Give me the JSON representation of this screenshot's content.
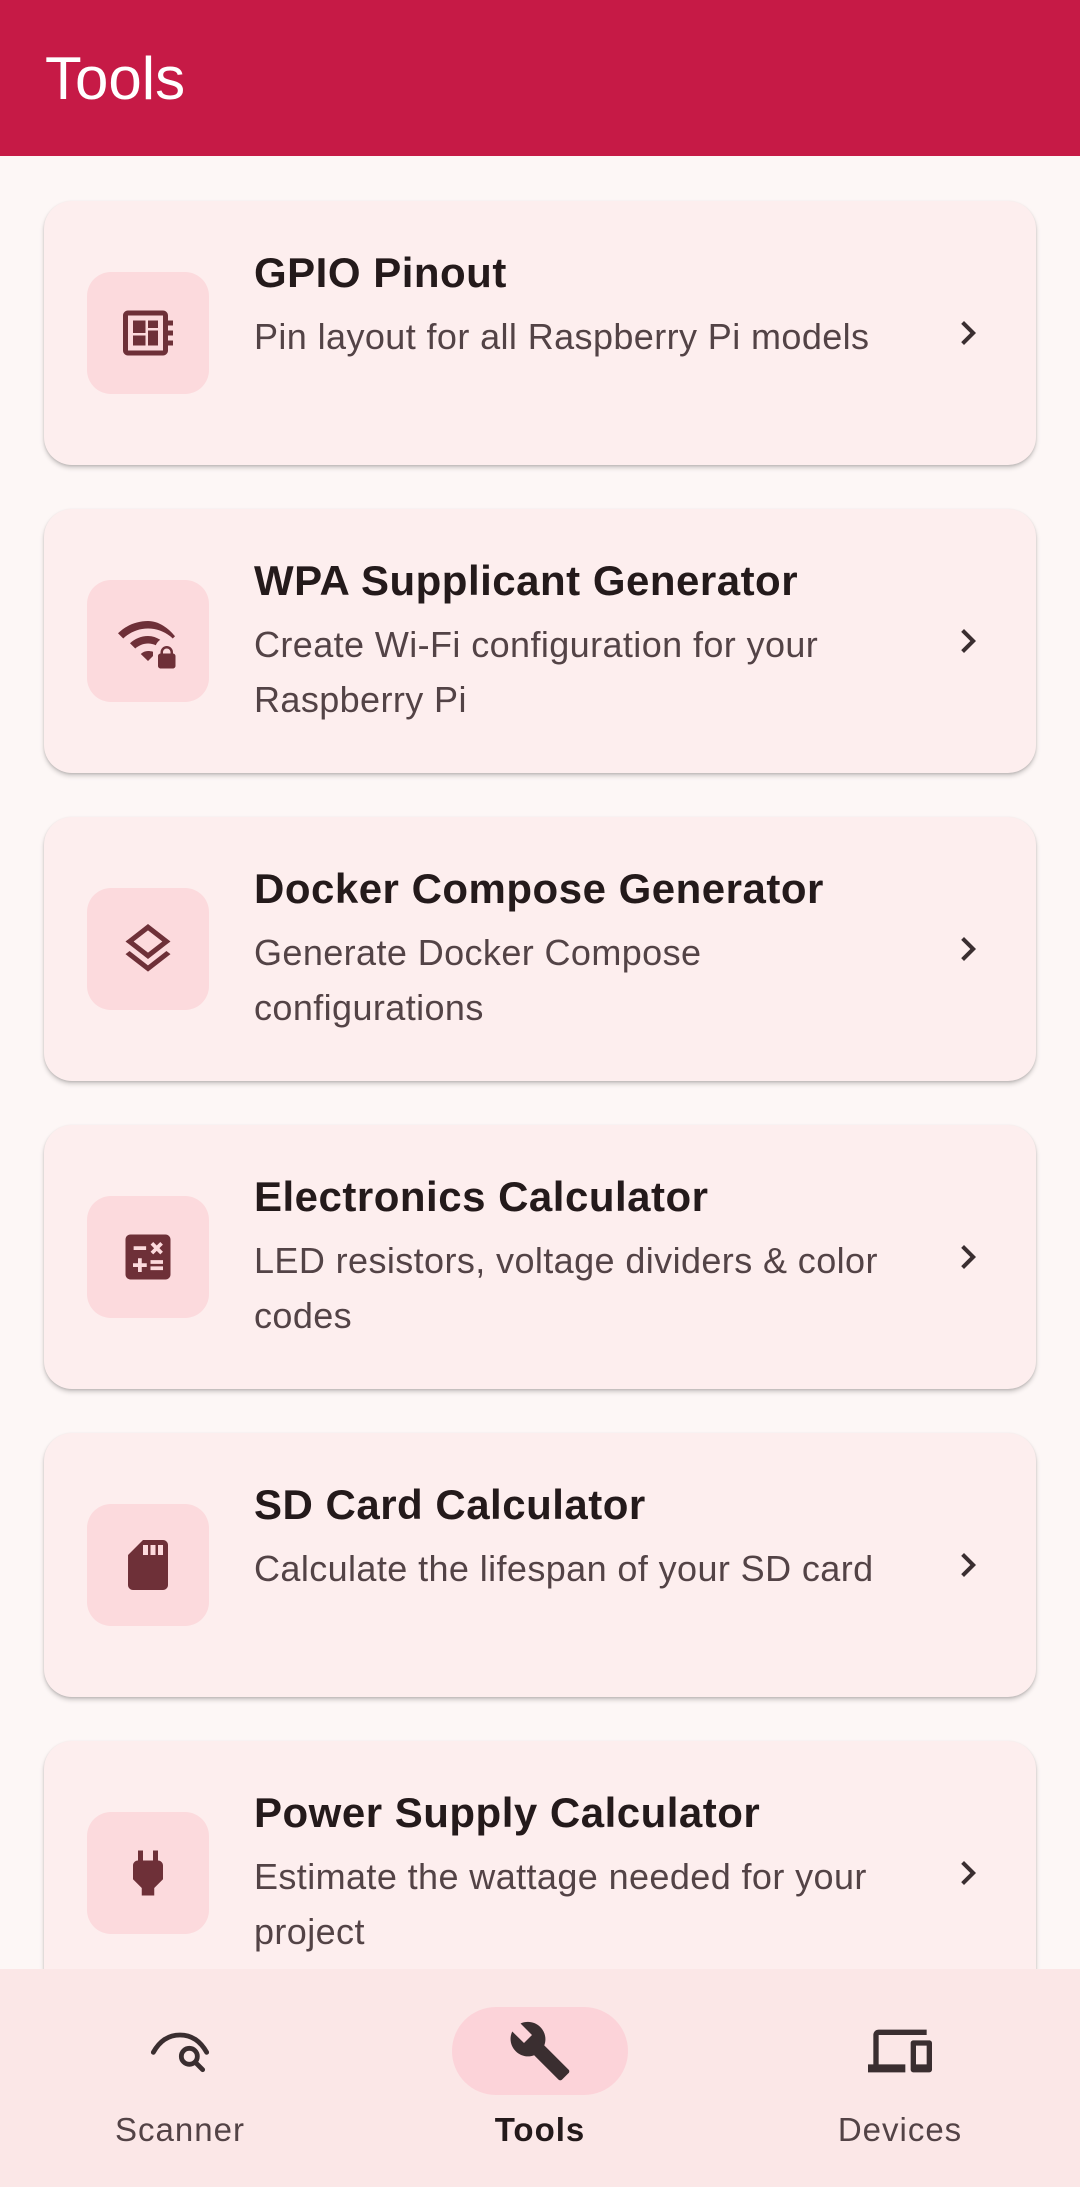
{
  "header": {
    "title": "Tools",
    "background": "#C61A46"
  },
  "tools": [
    {
      "title": "GPIO Pinout",
      "description": "Pin layout for all Raspberry Pi models",
      "icon": "developer-board-icon"
    },
    {
      "title": "WPA Supplicant Generator",
      "description": "Create Wi-Fi configuration for your Raspberry Pi",
      "icon": "wifi-lock-icon"
    },
    {
      "title": "Docker Compose Generator",
      "description": "Generate Docker Compose configurations",
      "icon": "layers-icon"
    },
    {
      "title": "Electronics Calculator",
      "description": "LED resistors, voltage dividers & color codes",
      "icon": "calculate-icon"
    },
    {
      "title": "SD Card Calculator",
      "description": "Calculate the lifespan of your SD card",
      "icon": "sd-card-icon"
    },
    {
      "title": "Power Supply Calculator",
      "description": "Estimate the wattage needed for your project",
      "icon": "power-plug-icon"
    }
  ],
  "bottom_nav": {
    "items": [
      {
        "label": "Scanner",
        "icon": "scan-eye-icon",
        "active": false
      },
      {
        "label": "Tools",
        "icon": "wrench-icon",
        "active": true
      },
      {
        "label": "Devices",
        "icon": "devices-icon",
        "active": false
      }
    ]
  },
  "colors": {
    "primary": "#C61A46",
    "icon": "#6E3038",
    "card": "#FDEEEE",
    "icon_container": "#FCDADD",
    "nav_active": "#FCD3D9"
  }
}
